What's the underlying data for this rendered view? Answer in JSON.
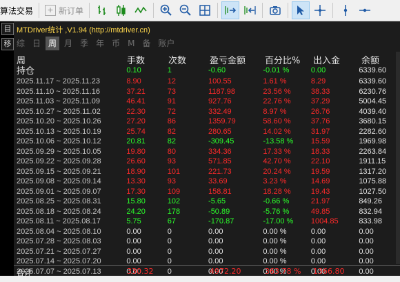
{
  "toolbar": {
    "algo_trading_label": "算法交易",
    "new_order_label": "新订单",
    "icons": [
      "bar-chart-icon",
      "candlestick-icon",
      "line-chart-icon",
      "zoom-in-icon",
      "zoom-out-icon",
      "tile-windows-icon",
      "autoscroll-icon",
      "chart-shift-icon",
      "screenshot-icon",
      "cursor-icon",
      "crosshair-icon",
      "vertical-line-icon",
      "horizontal-line-icon"
    ]
  },
  "left_strip": {
    "btn1": "目",
    "btn2": "移"
  },
  "panel": {
    "title": "MTDriver统计 ,V1.94 (http://mtdriver.cn)",
    "tabs": [
      "综",
      "日",
      "周",
      "月",
      "季",
      "年",
      "币",
      "M",
      "备",
      "账户"
    ],
    "active_tab": "周",
    "headers": {
      "period": "周",
      "lots": "手数",
      "count": "次数",
      "pnl": "盈亏金额",
      "pct": "百分比%",
      "flow": "出入金",
      "balance": "余额"
    },
    "rows": [
      {
        "label": "持仓",
        "lots": "0.10",
        "count": "1",
        "pnl": "-0.60",
        "pct": "-0.01 %",
        "flow": "0.00",
        "balance": "6339.60",
        "color": "green"
      },
      {
        "label": "2025.11.17 ~ 2025.11.23",
        "lots": "8.90",
        "count": "12",
        "pnl": "100.55",
        "pct": "1.61 %",
        "flow": "8.29",
        "balance": "6339.60",
        "color": "red"
      },
      {
        "label": "2025.11.10 ~ 2025.11.16",
        "lots": "37.21",
        "count": "73",
        "pnl": "1187.98",
        "pct": "23.56 %",
        "flow": "38.33",
        "balance": "6230.76",
        "color": "red"
      },
      {
        "label": "2025.11.03 ~ 2025.11.09",
        "lots": "46.41",
        "count": "91",
        "pnl": "927.76",
        "pct": "22.76 %",
        "flow": "37.29",
        "balance": "5004.45",
        "color": "red"
      },
      {
        "label": "2025.10.27 ~ 2025.11.02",
        "lots": "22.30",
        "count": "72",
        "pnl": "332.49",
        "pct": "8.97 %",
        "flow": "26.76",
        "balance": "4039.40",
        "color": "red"
      },
      {
        "label": "2025.10.20 ~ 2025.10.26",
        "lots": "27.20",
        "count": "86",
        "pnl": "1359.79",
        "pct": "58.60 %",
        "flow": "37.76",
        "balance": "3680.15",
        "color": "red"
      },
      {
        "label": "2025.10.13 ~ 2025.10.19",
        "lots": "25.74",
        "count": "82",
        "pnl": "280.65",
        "pct": "14.02 %",
        "flow": "31.97",
        "balance": "2282.60",
        "color": "red"
      },
      {
        "label": "2025.10.06 ~ 2025.10.12",
        "lots": "20.81",
        "count": "82",
        "pnl": "-309.45",
        "pct": "-13.58 %",
        "flow": "15.59",
        "balance": "1969.98",
        "color": "green",
        "flow_color": "red"
      },
      {
        "label": "2025.09.29 ~ 2025.10.05",
        "lots": "19.80",
        "count": "80",
        "pnl": "334.36",
        "pct": "17.33 %",
        "flow": "18.33",
        "balance": "2263.84",
        "color": "red"
      },
      {
        "label": "2025.09.22 ~ 2025.09.28",
        "lots": "26.60",
        "count": "93",
        "pnl": "571.85",
        "pct": "42.70 %",
        "flow": "22.10",
        "balance": "1911.15",
        "color": "red"
      },
      {
        "label": "2025.09.15 ~ 2025.09.21",
        "lots": "18.90",
        "count": "101",
        "pnl": "221.73",
        "pct": "20.24 %",
        "flow": "19.59",
        "balance": "1317.20",
        "color": "red"
      },
      {
        "label": "2025.09.08 ~ 2025.09.14",
        "lots": "13.30",
        "count": "93",
        "pnl": "33.69",
        "pct": "3.23 %",
        "flow": "14.69",
        "balance": "1075.88",
        "color": "red"
      },
      {
        "label": "2025.09.01 ~ 2025.09.07",
        "lots": "17.30",
        "count": "109",
        "pnl": "158.81",
        "pct": "18.28 %",
        "flow": "19.43",
        "balance": "1027.50",
        "color": "red"
      },
      {
        "label": "2025.08.25 ~ 2025.08.31",
        "lots": "15.80",
        "count": "102",
        "pnl": "-5.65",
        "pct": "-0.66 %",
        "flow": "21.97",
        "balance": "849.26",
        "color": "green",
        "flow_color": "red"
      },
      {
        "label": "2025.08.18 ~ 2025.08.24",
        "lots": "24.20",
        "count": "178",
        "pnl": "-50.89",
        "pct": "-5.76 %",
        "flow": "49.85",
        "balance": "832.94",
        "color": "green",
        "flow_color": "red"
      },
      {
        "label": "2025.08.11 ~ 2025.08.17",
        "lots": "5.75",
        "count": "67",
        "pnl": "-170.87",
        "pct": "-17.00 %",
        "flow": "1004.85",
        "balance": "833.98",
        "color": "green",
        "flow_color": "red"
      },
      {
        "label": "2025.08.04 ~ 2025.08.10",
        "lots": "0.00",
        "count": "0",
        "pnl": "0.00",
        "pct": "0.00 %",
        "flow": "0.00",
        "balance": "0.00",
        "color": "white"
      },
      {
        "label": "2025.07.28 ~ 2025.08.03",
        "lots": "0.00",
        "count": "0",
        "pnl": "0.00",
        "pct": "0.00 %",
        "flow": "0.00",
        "balance": "0.00",
        "color": "white"
      },
      {
        "label": "2025.07.21 ~ 2025.07.27",
        "lots": "0.00",
        "count": "0",
        "pnl": "0.00",
        "pct": "0.00 %",
        "flow": "0.00",
        "balance": "0.00",
        "color": "white"
      },
      {
        "label": "2025.07.14 ~ 2025.07.20",
        "lots": "0.00",
        "count": "0",
        "pnl": "0.00",
        "pct": "0.00 %",
        "flow": "0.00",
        "balance": "0.00",
        "color": "white"
      },
      {
        "label": "2025.07.07 ~ 2025.07.13",
        "lots": "0.00",
        "count": "0",
        "pnl": "0.00",
        "pct": "0.00 %",
        "flow": "0.00",
        "balance": "0.00",
        "color": "white"
      }
    ],
    "total": {
      "label": "合计",
      "lots": "330.32",
      "pnl": "4972.20",
      "pct": "363.78 %",
      "flow": "1366.80"
    }
  },
  "colors": {
    "red": "#ff2a2a",
    "green": "#2bff2b",
    "accent": "#ffd84d"
  }
}
